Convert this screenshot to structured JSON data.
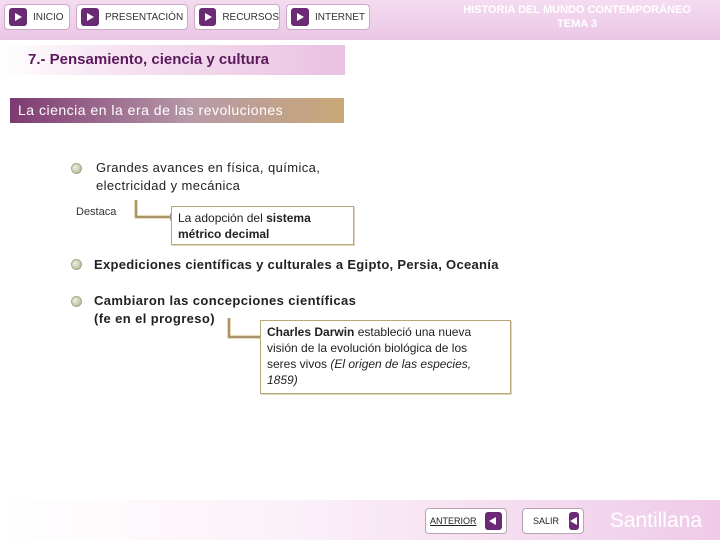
{
  "nav": {
    "inicio": "INICIO",
    "presentacion": "PRESENTACIÓN",
    "recursos": "RECURSOS",
    "internet": "INTERNET"
  },
  "header": {
    "subject_line1": "HISTORIA DEL MUNDO CONTEMPORÁNEO",
    "subject_line2": "TEMA 3"
  },
  "section": {
    "title": "7.- Pensamiento, ciencia y cultura",
    "subtitle": "La ciencia en la era de las revoluciones"
  },
  "content": {
    "bullet1_line1": "Grandes avances en física, química,",
    "bullet1_line2": "electricidad y mecánica",
    "destaca_label": "Destaca",
    "box1_pre": "La adopción del ",
    "box1_bold1": "sistema",
    "box1_bold2": "métrico decimal",
    "bullet2": "Expediciones científicas y culturales a Egipto, Persia, Oceanía",
    "bullet3_line1": "Cambiaron las concepciones científicas",
    "bullet3_line2": "(fe en el progreso)",
    "box2_bold": "Charles Darwin",
    "box2_rest1": " estableció una nueva",
    "box2_line2": "visión de la evolución biológica de los",
    "box2_line3_pre": "seres vivos ",
    "box2_line3_italic": "(El origen de las especies,",
    "box2_line4_italic": "1859)"
  },
  "footer": {
    "anterior": "ANTERIOR",
    "salir": "SALIR",
    "brand": "Santillana"
  },
  "colors": {
    "accent": "#6b2b74",
    "title": "#5a1a5c",
    "box_border": "#b8a678",
    "connector": "#d7b36a"
  }
}
